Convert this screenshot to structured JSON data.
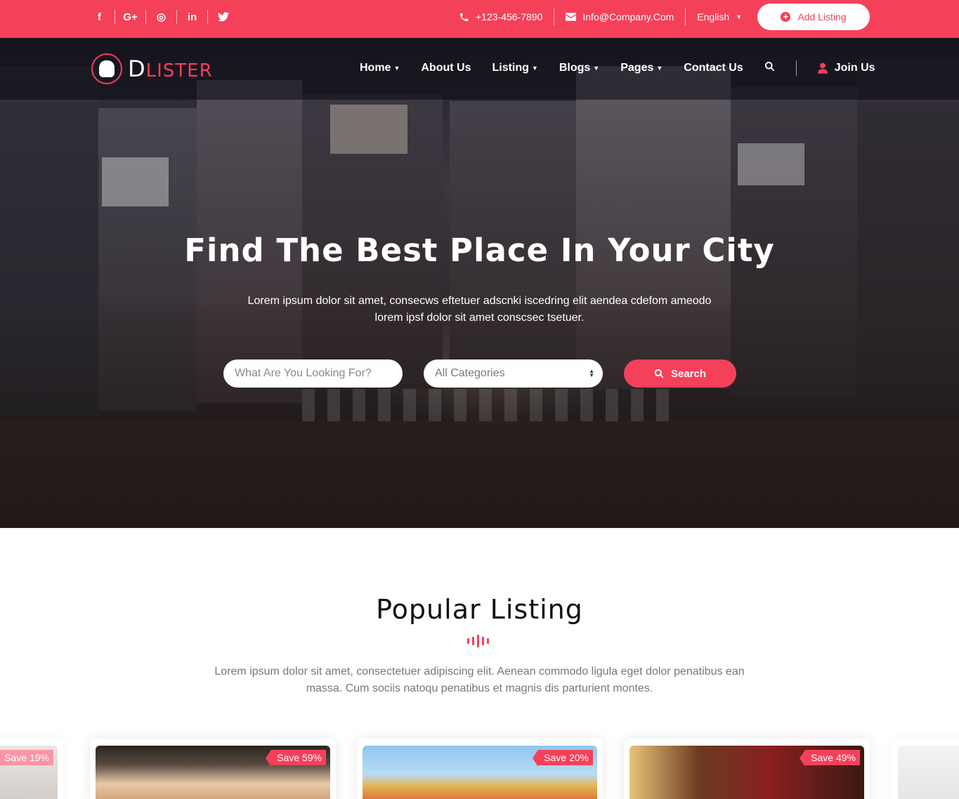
{
  "topbar": {
    "social": [
      "f",
      "G+",
      "◎",
      "in",
      "🐦"
    ],
    "phone": "+123-456-7890",
    "email": "Info@Company.Com",
    "language": "English",
    "add_listing": "Add Listing"
  },
  "nav": {
    "logo_first": "D",
    "logo_rest": "LISTER",
    "items": [
      {
        "label": "Home",
        "dropdown": true
      },
      {
        "label": "About Us",
        "dropdown": false
      },
      {
        "label": "Listing",
        "dropdown": true
      },
      {
        "label": "Blogs",
        "dropdown": true
      },
      {
        "label": "Pages",
        "dropdown": true
      },
      {
        "label": "Contact Us",
        "dropdown": false
      }
    ],
    "join": "Join Us"
  },
  "hero": {
    "title": "Find The Best Place In Your City",
    "subtitle": "Lorem ipsum dolor sit amet, consecws eftetuer adscnki iscedring elit aendea cdefom ameodo lorem ipsf dolor sit amet conscsec tsetuer.",
    "search_placeholder": "What Are You Looking For?",
    "category_value": "All Categories",
    "search_button": "Search"
  },
  "popular": {
    "title": "Popular Listing",
    "description": "Lorem ipsum dolor sit amet, consectetuer adipiscing elit. Aenean commodo ligula eget dolor penatibus ean massa. Cum sociis natoqu penatibus et magnis dis parturient montes.",
    "cards": [
      {
        "save": "Save 19%"
      },
      {
        "save": "Save 59%"
      },
      {
        "save": "Save 20%"
      },
      {
        "save": "Save 49%"
      },
      {
        "save": ""
      }
    ]
  },
  "colors": {
    "accent": "#f5405a"
  }
}
